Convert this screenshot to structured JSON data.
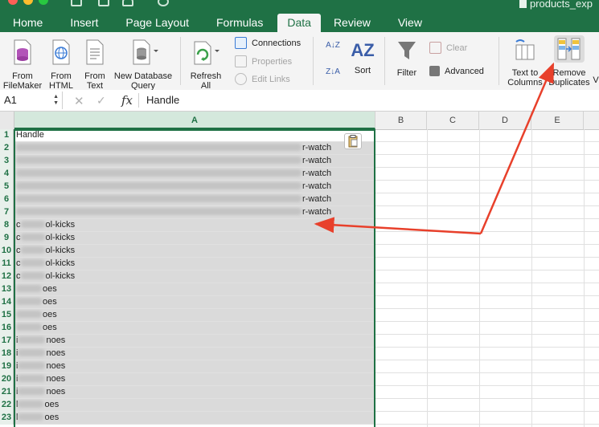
{
  "window": {
    "title": "products_exp"
  },
  "tabs": [
    {
      "label": "Home"
    },
    {
      "label": "Insert"
    },
    {
      "label": "Page Layout"
    },
    {
      "label": "Formulas"
    },
    {
      "label": "Data"
    },
    {
      "label": "Review"
    },
    {
      "label": "View"
    }
  ],
  "active_tab": "Data",
  "ribbon": {
    "from_filemaker": "From\nFileMaker",
    "from_html": "From\nHTML",
    "from_text": "From\nText",
    "new_db_query": "New Database\nQuery",
    "refresh_all": "Refresh\nAll",
    "connections": "Connections",
    "properties": "Properties",
    "edit_links": "Edit Links",
    "sort": "Sort",
    "filter": "Filter",
    "clear": "Clear",
    "advanced": "Advanced",
    "text_to_columns": "Text to\nColumns",
    "remove_duplicates": "Remove\nDuplicates",
    "az": "A↓Z",
    "za": "Z↓A",
    "sort_icon": "AZ",
    "next_cut": "V"
  },
  "formula_bar": {
    "cell_ref": "A1",
    "fx": "fx",
    "value": "Handle",
    "cancel": "✕",
    "enter": "✓"
  },
  "columns": [
    "A",
    "B",
    "C",
    "D",
    "E"
  ],
  "rows": [
    {
      "n": "1",
      "prefix": "",
      "suffix": "Handle",
      "blur": 0
    },
    {
      "n": "2",
      "prefix": "",
      "suffix": "r-watch",
      "blur": 355
    },
    {
      "n": "3",
      "prefix": "",
      "suffix": "r-watch",
      "blur": 355
    },
    {
      "n": "4",
      "prefix": "",
      "suffix": "r-watch",
      "blur": 355
    },
    {
      "n": "5",
      "prefix": "",
      "suffix": "r-watch",
      "blur": 355
    },
    {
      "n": "6",
      "prefix": "",
      "suffix": "r-watch",
      "blur": 355
    },
    {
      "n": "7",
      "prefix": "",
      "suffix": "r-watch",
      "blur": 355
    },
    {
      "n": "8",
      "prefix": "c",
      "suffix": "ol-kicks",
      "blur": 30
    },
    {
      "n": "9",
      "prefix": "c",
      "suffix": "ol-kicks",
      "blur": 30
    },
    {
      "n": "10",
      "prefix": "c",
      "suffix": "ol-kicks",
      "blur": 30
    },
    {
      "n": "11",
      "prefix": "c",
      "suffix": "ol-kicks",
      "blur": 30
    },
    {
      "n": "12",
      "prefix": "c",
      "suffix": "ol-kicks",
      "blur": 30
    },
    {
      "n": "13",
      "prefix": "",
      "suffix": "oes",
      "blur": 32
    },
    {
      "n": "14",
      "prefix": "",
      "suffix": "oes",
      "blur": 32
    },
    {
      "n": "15",
      "prefix": "",
      "suffix": "oes",
      "blur": 32
    },
    {
      "n": "16",
      "prefix": "",
      "suffix": "oes",
      "blur": 32
    },
    {
      "n": "17",
      "prefix": "i",
      "suffix": "noes",
      "blur": 34
    },
    {
      "n": "18",
      "prefix": "i",
      "suffix": "noes",
      "blur": 34
    },
    {
      "n": "19",
      "prefix": "i",
      "suffix": "noes",
      "blur": 34
    },
    {
      "n": "20",
      "prefix": "i",
      "suffix": "noes",
      "blur": 34
    },
    {
      "n": "21",
      "prefix": "i",
      "suffix": "noes",
      "blur": 34
    },
    {
      "n": "22",
      "prefix": "l",
      "suffix": "oes",
      "blur": 32
    },
    {
      "n": "23",
      "prefix": "l",
      "suffix": "oes",
      "blur": 32
    }
  ],
  "colors": {
    "excel_green": "#1f7145",
    "annotation_red": "#e8402b",
    "selection_gray": "#dadada"
  }
}
